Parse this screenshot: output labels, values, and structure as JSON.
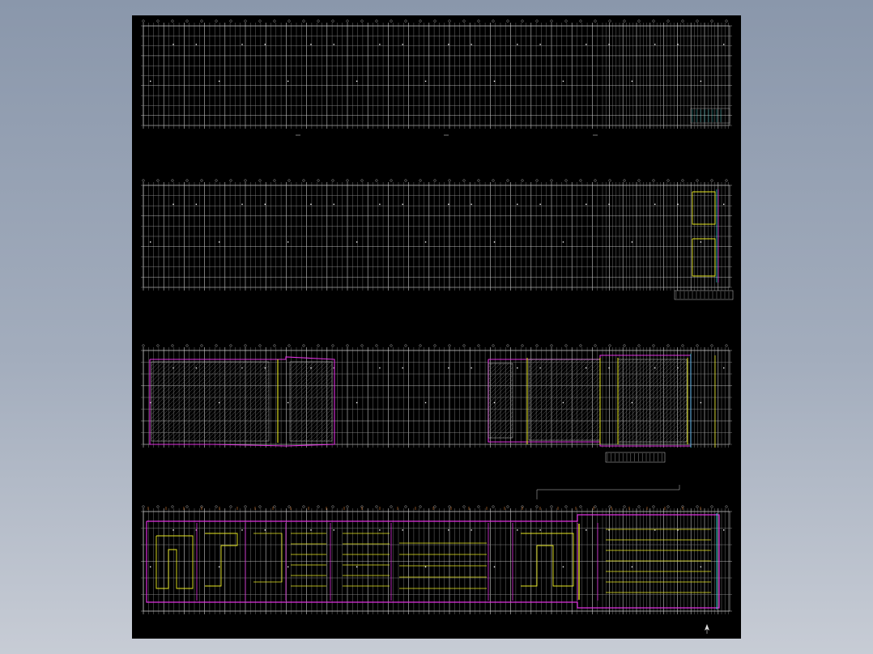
{
  "drawing": {
    "plans": [
      {
        "id": "plan-1",
        "kind": "structural-grid"
      },
      {
        "id": "plan-2",
        "kind": "structural-grid-with-core"
      },
      {
        "id": "plan-3",
        "kind": "partial-floor-plan"
      },
      {
        "id": "plan-4",
        "kind": "full-floor-plan"
      }
    ],
    "colors": {
      "sheet_background": "#000000",
      "grid": "#8c8c8c",
      "grid_bright": "#c8c8c8",
      "wall_magenta": "#e030e0",
      "yellow": "#e8e820",
      "cyan": "#30e0e0",
      "hatch": "#6a6a6a",
      "orange": "#d87a30"
    },
    "north_arrow_icon": "north-arrow-icon"
  }
}
